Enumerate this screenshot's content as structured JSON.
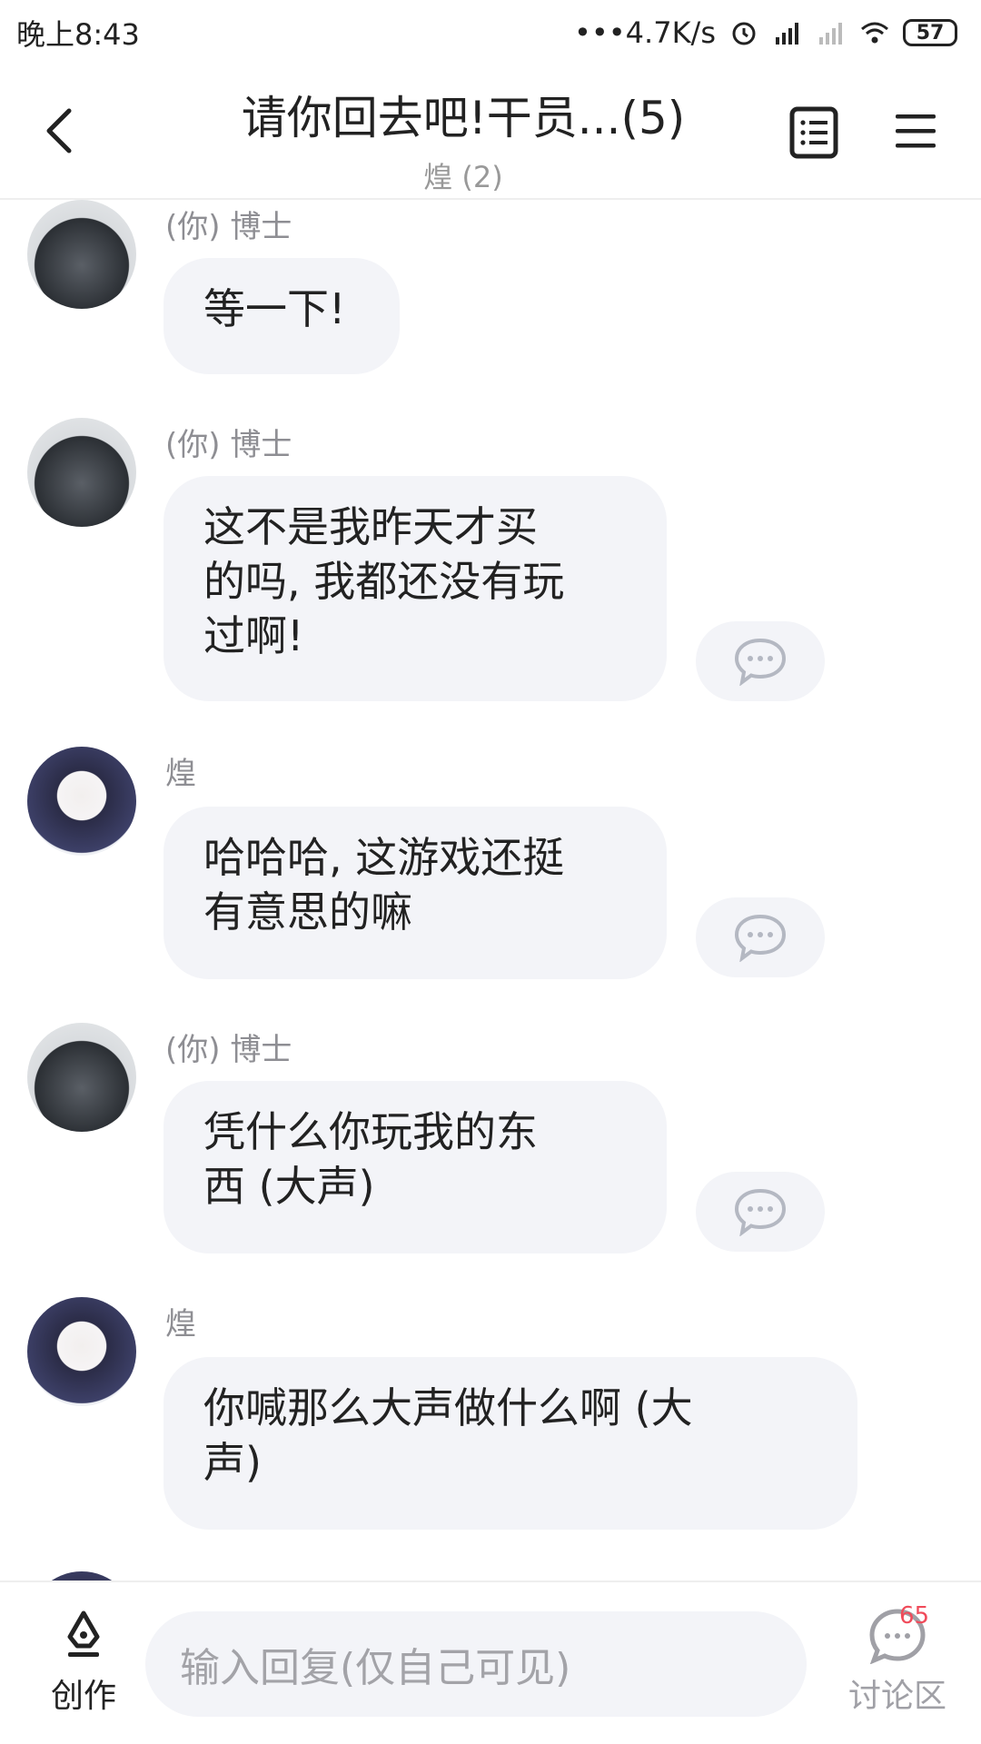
{
  "status_bar": {
    "time": "晚上8:43",
    "network_speed": "•••4.7K/s",
    "battery": "57"
  },
  "header": {
    "title": "请你回去吧!干员...(5)",
    "subtitle": "煌 (2)"
  },
  "messages": [
    {
      "sender": "(你) 博士",
      "text": "等一下!"
    },
    {
      "sender": "(你) 博士",
      "text": "这不是我昨天才买\n的吗, 我都还没有玩\n过啊!"
    },
    {
      "sender": "煌",
      "text": "哈哈哈, 这游戏还挺\n有意思的嘛"
    },
    {
      "sender": "(你) 博士",
      "text": "凭什么你玩我的东\n西 (大声)"
    },
    {
      "sender": "煌",
      "text": "你喊那么大声做什么啊 (大\n声)"
    }
  ],
  "bottom_bar": {
    "create_label": "创作",
    "input_placeholder": "输入回复(仅自己可见)",
    "discussion_label": "讨论区",
    "discussion_count": "65"
  }
}
